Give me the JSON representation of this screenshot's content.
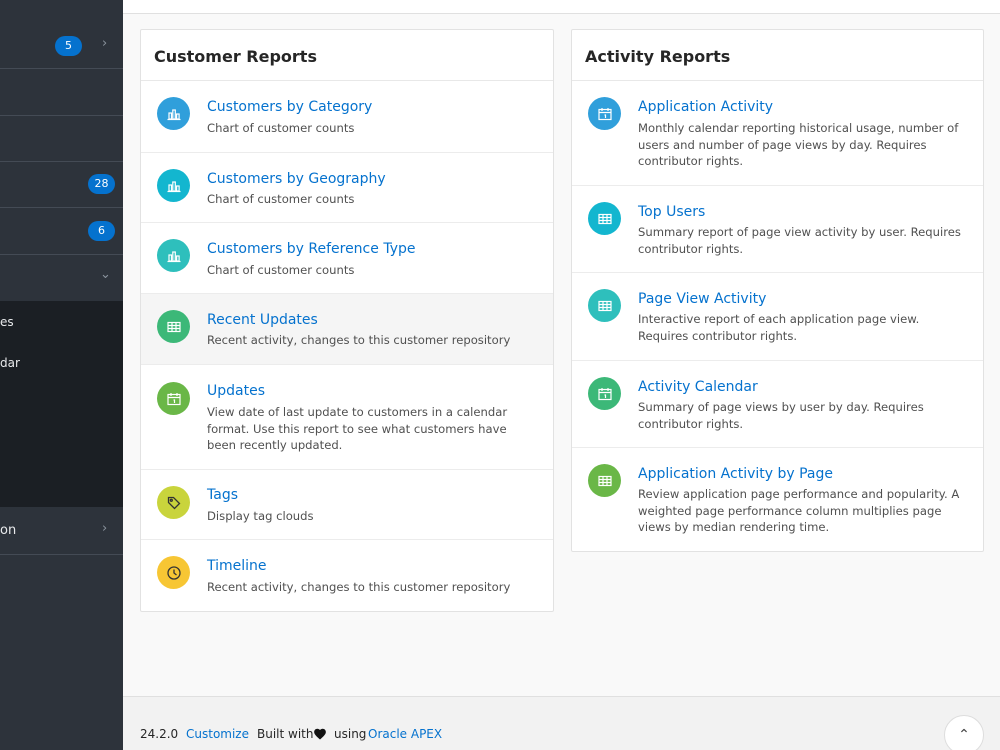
{
  "sidebar": {
    "items": [
      {
        "label": "",
        "badge": "5",
        "chevron": "›"
      },
      {
        "label": "",
        "badge": "",
        "chevron": ""
      },
      {
        "label": "",
        "badge": "",
        "chevron": ""
      },
      {
        "label": "",
        "badge": "28",
        "chevron": ""
      },
      {
        "label": "",
        "badge": "6",
        "chevron": ""
      },
      {
        "label": "",
        "badge": "",
        "chevron": "⌄"
      },
      {
        "label": "on",
        "badge": "",
        "chevron": "›"
      }
    ],
    "sub_items": [
      "es",
      "dar"
    ]
  },
  "customer_reports": {
    "title": "Customer Reports",
    "items": [
      {
        "title": "Customers by Category",
        "desc": "Chart of customer counts",
        "icon": "bar-chart-icon",
        "color": "#309fdb"
      },
      {
        "title": "Customers by Geography",
        "desc": "Chart of customer counts",
        "icon": "bar-chart-icon",
        "color": "#13b6cf"
      },
      {
        "title": "Customers by Reference Type",
        "desc": "Chart of customer counts",
        "icon": "bar-chart-icon",
        "color": "#2ebfbc"
      },
      {
        "title": "Recent Updates",
        "desc": "Recent activity, changes to this customer repository",
        "icon": "table-icon",
        "color": "#3cb878"
      },
      {
        "title": "Updates",
        "desc": "View date of last update to customers in a calendar format. Use this report to see what customers have been recently updated.",
        "icon": "calendar-icon",
        "color": "#6ab747"
      },
      {
        "title": "Tags",
        "desc": "Display tag clouds",
        "icon": "tag-icon",
        "color": "#c9d43c"
      },
      {
        "title": "Timeline",
        "desc": "Recent activity, changes to this customer repository",
        "icon": "clock-icon",
        "color": "#f7c634"
      }
    ]
  },
  "activity_reports": {
    "title": "Activity Reports",
    "items": [
      {
        "title": "Application Activity",
        "desc": "Monthly calendar reporting historical usage, number of users and number of page views by day. Requires contributor rights.",
        "icon": "calendar-icon",
        "color": "#309fdb"
      },
      {
        "title": "Top Users",
        "desc": "Summary report of page view activity by user. Requires contributor rights.",
        "icon": "table-icon",
        "color": "#13b6cf"
      },
      {
        "title": "Page View Activity",
        "desc": "Interactive report of each application page view. Requires contributor rights.",
        "icon": "table-icon",
        "color": "#2ebfbc"
      },
      {
        "title": "Activity Calendar",
        "desc": "Summary of page views by user by day. Requires contributor rights.",
        "icon": "calendar-icon",
        "color": "#3cb878"
      },
      {
        "title": "Application Activity by Page",
        "desc": "Review application page performance and popularity. A weighted page performance column multiplies page views by median rendering time.",
        "icon": "table-icon",
        "color": "#6ab747"
      }
    ]
  },
  "footer": {
    "version": "24.2.0",
    "customize": "Customize",
    "built_with": "Built with",
    "using": "using",
    "apex": "Oracle APEX",
    "to_top": "⌃"
  }
}
